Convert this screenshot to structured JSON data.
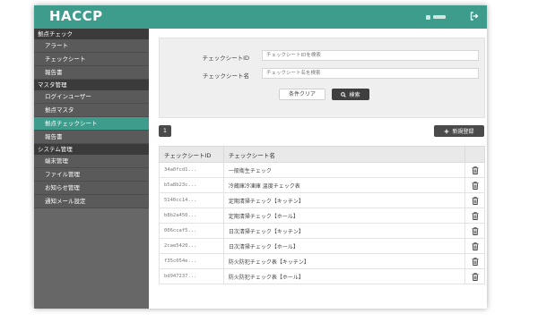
{
  "app": {
    "title": "HACCP"
  },
  "sidebar": {
    "sections": [
      {
        "label": "拠点チェック",
        "items": [
          {
            "label": "アラート"
          },
          {
            "label": "チェックシート"
          },
          {
            "label": "報告書"
          }
        ]
      },
      {
        "label": "マスタ管理",
        "items": [
          {
            "label": "ログインユーザー"
          },
          {
            "label": "拠点マスタ"
          },
          {
            "label": "拠点チェックシート",
            "active": true
          },
          {
            "label": "報告書"
          }
        ]
      },
      {
        "label": "システム管理",
        "items": [
          {
            "label": "端末管理"
          },
          {
            "label": "ファイル管理"
          },
          {
            "label": "お知らせ管理"
          },
          {
            "label": "通知メール設定"
          }
        ]
      }
    ]
  },
  "search": {
    "id_label": "チェックシートID",
    "id_placeholder": "チェックシートIDを検索",
    "name_label": "チェックシート名",
    "name_placeholder": "チェックシート名を検索",
    "clear_label": "条件クリア",
    "search_label": "検索"
  },
  "pagination": {
    "current": "1"
  },
  "actions": {
    "new_label": "新規登録"
  },
  "table": {
    "headers": [
      "チェックシートID",
      "チェックシート名"
    ],
    "rows": [
      {
        "id": "34a0fcd1...",
        "name": "一般衛生チェック"
      },
      {
        "id": "b5a8b23c...",
        "name": "冷蔵庫冷凍庫 温度チェック表"
      },
      {
        "id": "5140cc14...",
        "name": "定期清掃チェック【キッチン】"
      },
      {
        "id": "b8b2a450...",
        "name": "定期清掃チェック【ホール】"
      },
      {
        "id": "006ccaf5...",
        "name": "日次清掃チェック【キッチン】"
      },
      {
        "id": "2cae5420...",
        "name": "日次清掃チェック【ホール】"
      },
      {
        "id": "f35c054e...",
        "name": "防火防犯チェック表【キッチン】"
      },
      {
        "id": "bd947237...",
        "name": "防火防犯チェック表【ホール】"
      }
    ]
  },
  "colors": {
    "accent": "#3d9c8c",
    "sidebar": "#676767",
    "sidebar_section": "#3b3b3b",
    "dark_button": "#4a4a4a"
  },
  "icons": {
    "search": "search-icon",
    "plus": "plus-icon",
    "logout": "logout-icon",
    "delete": "trash-icon"
  }
}
